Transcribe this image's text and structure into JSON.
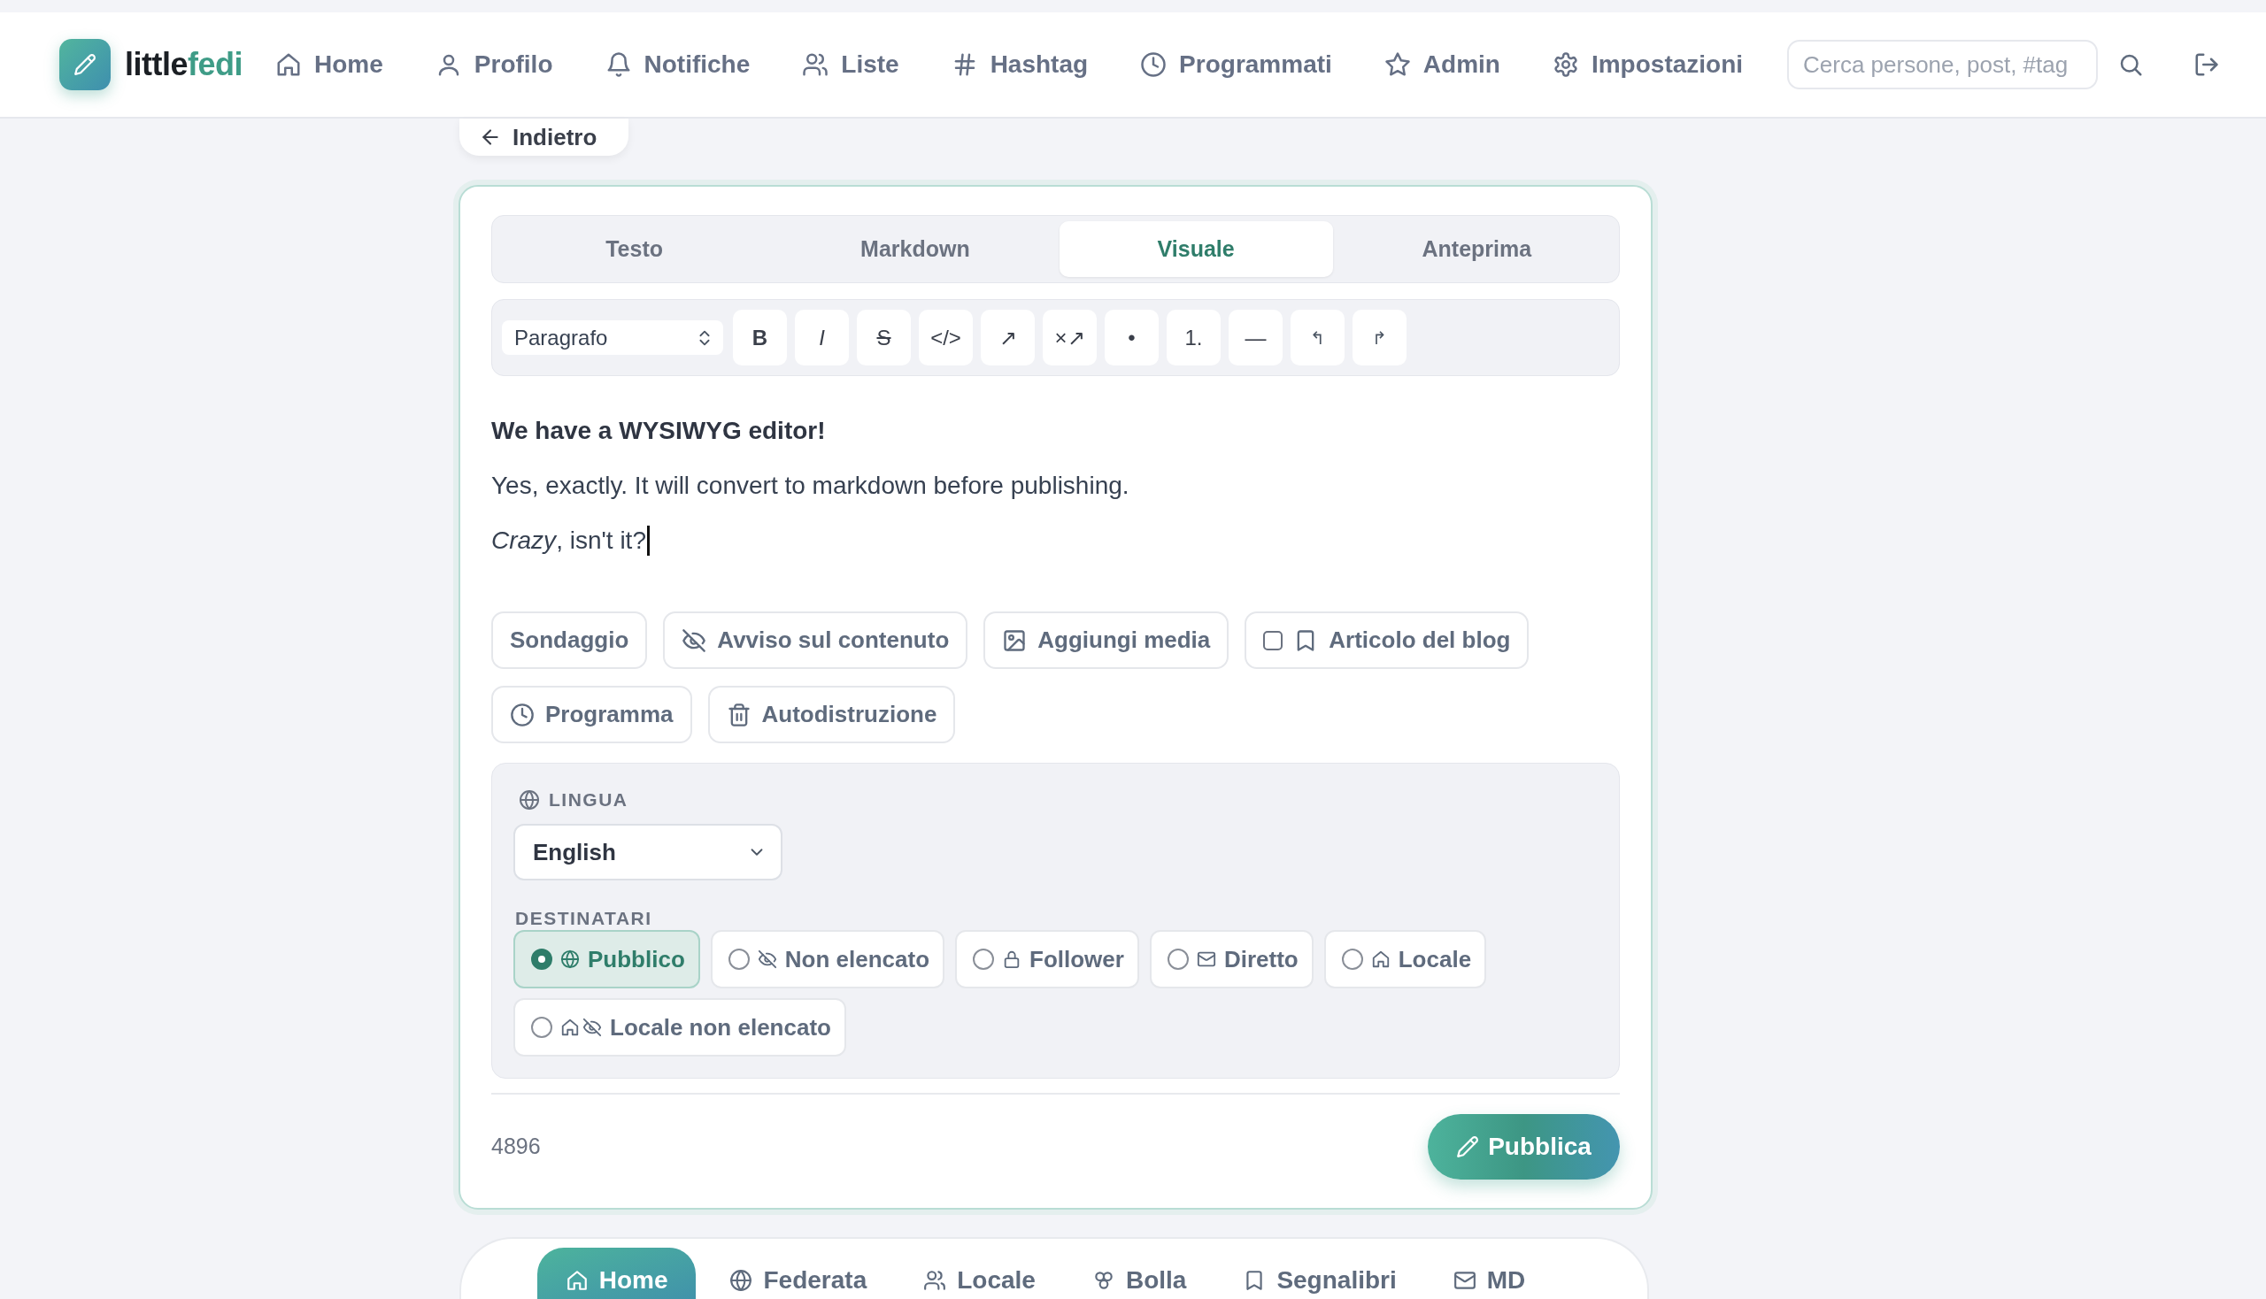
{
  "header": {
    "logo_text": [
      {
        "text": "little",
        "color": "#1b1f24"
      },
      {
        "text": "fedi",
        "color": "#3f9c87"
      }
    ],
    "nav": [
      {
        "label": "Home"
      },
      {
        "label": "Profilo"
      },
      {
        "label": "Notifiche"
      },
      {
        "label": "Liste"
      },
      {
        "label": "Hashtag"
      },
      {
        "label": "Programmati"
      },
      {
        "label": "Admin"
      },
      {
        "label": "Impostazioni"
      }
    ],
    "search": {
      "placeholder": "Cerca persone, post, #tag"
    }
  },
  "back_button": {
    "label": "Indietro"
  },
  "editor": {
    "tabs": [
      {
        "label": "Testo",
        "selected": false
      },
      {
        "label": "Markdown",
        "selected": false
      },
      {
        "label": "Visuale",
        "selected": true
      },
      {
        "label": "Anteprima",
        "selected": false
      }
    ],
    "toolbar": {
      "block_format": "Paragrafo",
      "buttons": [
        {
          "label": "B",
          "kind": "bold"
        },
        {
          "label": "I",
          "kind": "italic"
        },
        {
          "label": "S",
          "kind": "strike"
        },
        {
          "label": "</>",
          "kind": "code"
        },
        {
          "label": "↗",
          "kind": "link"
        },
        {
          "label": "×↗",
          "kind": "unlink"
        },
        {
          "label": "•",
          "kind": "bullet"
        },
        {
          "label": "1.",
          "kind": "ordered"
        },
        {
          "label": "—",
          "kind": "rule"
        },
        {
          "label": "↰",
          "kind": "undo"
        },
        {
          "label": "↱",
          "kind": "redo"
        }
      ]
    },
    "content": [
      {
        "text": "We have a WYSIWYG editor!",
        "bold": true,
        "caret": false
      },
      {
        "text": "Yes, exactly. It will convert to markdown before publishing.",
        "bold": false,
        "caret": false
      },
      {
        "text": "*Crazy*, isn't it?",
        "bold": false,
        "caret": true
      }
    ],
    "actions": [
      {
        "kind": "button",
        "label": "Sondaggio"
      },
      {
        "kind": "button",
        "label": "Avviso sul contenuto"
      },
      {
        "kind": "button",
        "label": "Aggiungi media"
      },
      {
        "kind": "checkbox",
        "label": "Articolo del blog",
        "checked": false
      },
      {
        "kind": "button",
        "label": "Programma"
      },
      {
        "kind": "button",
        "label": "Autodistruzione"
      }
    ],
    "language": {
      "label": "LINGUA",
      "value": "English"
    },
    "audience": {
      "label": "DESTINATARI",
      "options": [
        {
          "label": "Pubblico",
          "selected": true
        },
        {
          "label": "Non elencato",
          "selected": false
        },
        {
          "label": "Follower",
          "selected": false
        },
        {
          "label": "Diretto",
          "selected": false
        },
        {
          "label": "Locale",
          "selected": false
        },
        {
          "label": "Locale non elencato",
          "selected": false
        }
      ]
    },
    "char_count": "4896",
    "publish_button": {
      "label": "Pubblica"
    }
  },
  "bottom_nav": [
    {
      "label": "Home",
      "selected": true
    },
    {
      "label": "Federata",
      "selected": false
    },
    {
      "label": "Locale",
      "selected": false
    },
    {
      "label": "Bolla",
      "selected": false
    },
    {
      "label": "Segnalibri",
      "selected": false
    },
    {
      "label": "MD",
      "selected": false
    }
  ]
}
